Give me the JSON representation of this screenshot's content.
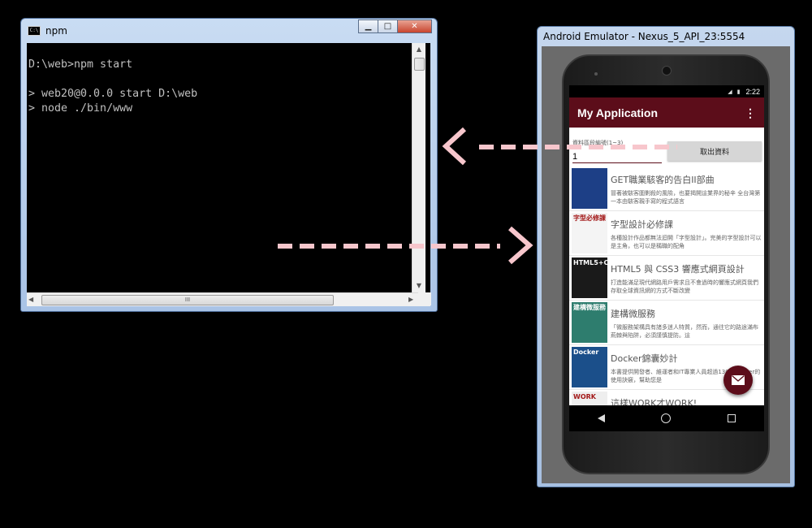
{
  "console": {
    "title": "npm",
    "icon_label": "C:\\",
    "output": "D:\\web>npm start\n\n> web20@0.0.0 start D:\\web\n> node ./bin/www",
    "hscroll_grip": "III"
  },
  "emulator": {
    "title": "Android Emulator - Nexus_5_API_23:5554",
    "status": {
      "time": "2:22",
      "icons": "◢ ▮"
    },
    "app": {
      "title": "My Application",
      "field_label": "資料區段編號(1~3)",
      "field_value": "1",
      "fetch_label": "取出資料",
      "books": [
        {
          "title": "GET職業駭客的告白II部曲",
          "desc": "冒著被駭客圍剿殺的風險，也要揭開這業界的秘辛 全台灣第一本由駭客親手寫的程式語言",
          "cover_color": "#1d3f86",
          "cover_text": ""
        },
        {
          "title": "字型設計必修課",
          "desc": "各種設計作品都無法迴開「字型設計」。完美的字型設計可以是主角，也可以是稱職的配角",
          "cover_color": "#f4f4f4",
          "cover_text": "字型必修課"
        },
        {
          "title": "HTML5 與 CSS3 響應式網頁設計",
          "desc": "打造能滿足現代網路用戶需求且不會過時的響應式網頁我們存取全球資訊網的方式不斷改變",
          "cover_color": "#1a1a1a",
          "cover_text": "HTML5+CSS3"
        },
        {
          "title": "建構微服務",
          "desc": "「微服務架構具有諸多迷人特質，然而，通往它的路途滿布荊棘與陷阱，必須謹慎提防。這",
          "cover_color": "#2e7d6e",
          "cover_text": "建構微服務"
        },
        {
          "title": "Docker錦囊妙計",
          "desc": "本書提供開發者、維運者和IT專業人員超過130個Docker的使用訣竅，幫助您是",
          "cover_color": "#1b4f8a",
          "cover_text": "Docker"
        },
        {
          "title": "這樣WORK才WORK!",
          "desc": "",
          "cover_color": "#eeeeee",
          "cover_text": "WORK"
        }
      ]
    }
  },
  "colors": {
    "accent": "#5c0d1a",
    "arrow": "#f7c6cc"
  }
}
